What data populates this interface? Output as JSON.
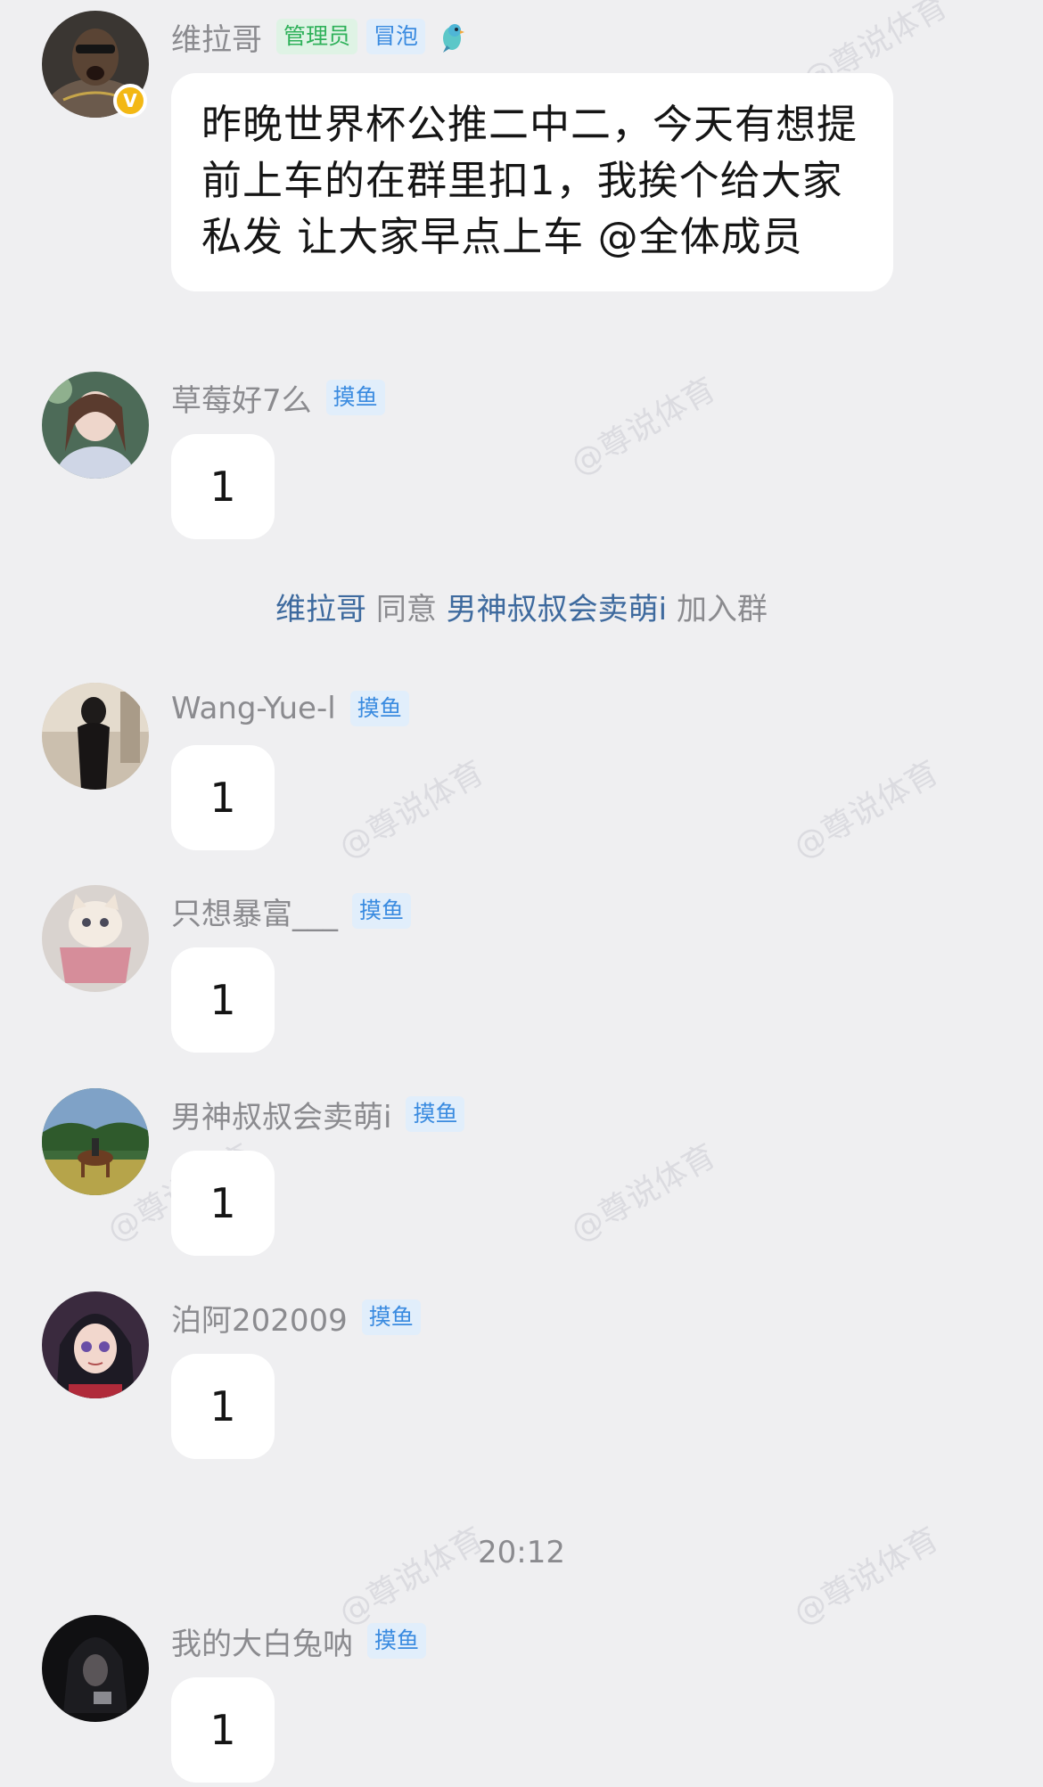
{
  "messages": [
    {
      "name": "维拉哥",
      "tags": [
        "管理员",
        "冒泡"
      ],
      "text": "昨晚世界杯公推二中二，今天有想提前上车的在群里扣1，我挨个给大家私发  让大家早点上车 @全体成员"
    },
    {
      "name": "草莓好7么",
      "tag": "摸鱼",
      "text": "1"
    },
    {
      "name": "Wang-Yue-l",
      "tag": "摸鱼",
      "text": "1"
    },
    {
      "name": "只想暴富___",
      "tag": "摸鱼",
      "text": "1"
    },
    {
      "name": "男神叔叔会卖萌i",
      "tag": "摸鱼",
      "text": "1"
    },
    {
      "name": "泊阿202009",
      "tag": "摸鱼",
      "text": "1"
    },
    {
      "name": "我的大白兔呐",
      "tag": "摸鱼",
      "text": "1"
    }
  ],
  "system": {
    "actor": "维拉哥",
    "verb": "同意",
    "target": "男神叔叔会卖萌i",
    "action": "加入群"
  },
  "time_divider": "20:12",
  "watermark": "@尊说体育",
  "colors": {
    "background": "#efeff1",
    "admin_tag": "#2fb15a",
    "blue_tag": "#3a8be0",
    "link": "#3e6a9e",
    "verified_badge": "#f3b814"
  }
}
